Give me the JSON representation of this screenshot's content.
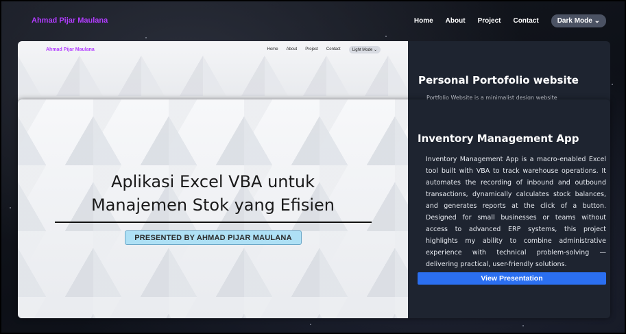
{
  "header": {
    "brand": "Ahmad Pijar Maulana",
    "nav": [
      "Home",
      "About",
      "Project",
      "Contact"
    ],
    "mode_button": "Dark Mode",
    "mode_icon": "chevron-down-icon"
  },
  "projects": [
    {
      "preview": {
        "brand": "Ahmad Pijar Maulana",
        "nav": [
          "Home",
          "About",
          "Project",
          "Contact"
        ],
        "mode_button": "Light Mode"
      },
      "title": "Personal Portofolio website",
      "description_partial": "Portfolio Website is a minimalist design website"
    },
    {
      "slide": {
        "title_line1": "Aplikasi Excel VBA untuk",
        "title_line2": "Manajemen Stok yang Efisien",
        "presented_by": "PRESENTED BY AHMAD PIJAR MAULANA"
      },
      "title": "Inventory Management App",
      "description": "Inventory Management App is a macro-enabled Excel tool built with VBA to track warehouse operations. It automates the recording of inbound and outbound transactions, dynamically calculates stock balances, and generates reports at the click of a button. Designed for small businesses or teams without access to advanced ERP systems, this project highlights my ability to combine administrative experience with technical problem-solving — delivering practical, user-friendly solutions.",
      "button": "View Presentation"
    }
  ],
  "colors": {
    "brand": "#b23cff",
    "accent_button": "#2b6ff0",
    "card_bg": "#1e2430"
  }
}
